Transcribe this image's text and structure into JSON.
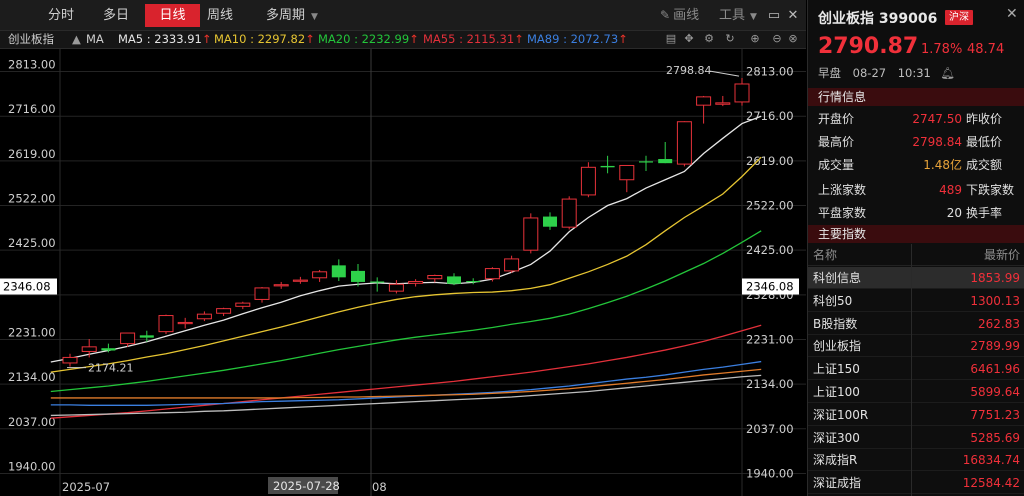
{
  "topbar": {
    "tabs": [
      {
        "label": "分时",
        "active": false
      },
      {
        "label": "多日",
        "active": false
      },
      {
        "label": "日线",
        "active": true
      },
      {
        "label": "周线",
        "active": false
      },
      {
        "label": "多周期",
        "active": false
      }
    ],
    "draw_label": "画线",
    "tools_label": "工具",
    "colors": {
      "active_tab": "#d9232d"
    }
  },
  "indicator_bar": {
    "symbol": "创业板指",
    "type": "MA",
    "ma": [
      {
        "label": "MA5 : 2333.91",
        "color": "#e6e6e6"
      },
      {
        "label": "MA10 : 2297.82",
        "color": "#e6c532"
      },
      {
        "label": "MA20 : 2232.99",
        "color": "#23c53a"
      },
      {
        "label": "MA55 : 2115.31",
        "color": "#e3303a"
      },
      {
        "label": "MA89 : 2072.73",
        "color": "#3b7fe0"
      }
    ],
    "arrow": "↑"
  },
  "chart_data": {
    "type": "candlestick",
    "ylim": [
      1891,
      2862
    ],
    "y_ticks": [
      "2813.00",
      "2716.00",
      "2619.00",
      "2522.00",
      "2425.00",
      "2328.00",
      "2231.00",
      "2134.00",
      "2037.00",
      "1940.00"
    ],
    "current_price_label": "2346.08",
    "x_labels": [
      "2025-07",
      "2025-07-28",
      "08"
    ],
    "high_marker": "2798.84",
    "low_marker": "2174.21",
    "candles": [
      {
        "o": 2180,
        "h": 2200,
        "l": 2172,
        "c": 2192
      },
      {
        "o": 2205,
        "h": 2232,
        "l": 2192,
        "c": 2215
      },
      {
        "o": 2212,
        "h": 2222,
        "l": 2203,
        "c": 2207
      },
      {
        "o": 2222,
        "h": 2240,
        "l": 2215,
        "c": 2245
      },
      {
        "o": 2240,
        "h": 2250,
        "l": 2226,
        "c": 2235
      },
      {
        "o": 2248,
        "h": 2285,
        "l": 2243,
        "c": 2283
      },
      {
        "o": 2268,
        "h": 2278,
        "l": 2255,
        "c": 2268
      },
      {
        "o": 2276,
        "h": 2292,
        "l": 2271,
        "c": 2286
      },
      {
        "o": 2288,
        "h": 2300,
        "l": 2282,
        "c": 2298
      },
      {
        "o": 2303,
        "h": 2313,
        "l": 2297,
        "c": 2310
      },
      {
        "o": 2318,
        "h": 2345,
        "l": 2311,
        "c": 2343
      },
      {
        "o": 2350,
        "h": 2356,
        "l": 2341,
        "c": 2350
      },
      {
        "o": 2360,
        "h": 2367,
        "l": 2352,
        "c": 2360
      },
      {
        "o": 2365,
        "h": 2382,
        "l": 2356,
        "c": 2378
      },
      {
        "o": 2392,
        "h": 2405,
        "l": 2358,
        "c": 2366
      },
      {
        "o": 2380,
        "h": 2395,
        "l": 2346,
        "c": 2356
      },
      {
        "o": 2357,
        "h": 2366,
        "l": 2335,
        "c": 2356
      },
      {
        "o": 2336,
        "h": 2360,
        "l": 2331,
        "c": 2351
      },
      {
        "o": 2353,
        "h": 2362,
        "l": 2346,
        "c": 2357
      },
      {
        "o": 2363,
        "h": 2372,
        "l": 2355,
        "c": 2370
      },
      {
        "o": 2368,
        "h": 2375,
        "l": 2349,
        "c": 2352
      },
      {
        "o": 2358,
        "h": 2364,
        "l": 2351,
        "c": 2356
      },
      {
        "o": 2363,
        "h": 2388,
        "l": 2357,
        "c": 2385
      },
      {
        "o": 2380,
        "h": 2413,
        "l": 2376,
        "c": 2406
      },
      {
        "o": 2425,
        "h": 2505,
        "l": 2418,
        "c": 2495
      },
      {
        "o": 2498,
        "h": 2507,
        "l": 2469,
        "c": 2476
      },
      {
        "o": 2475,
        "h": 2542,
        "l": 2470,
        "c": 2536
      },
      {
        "o": 2545,
        "h": 2616,
        "l": 2540,
        "c": 2605
      },
      {
        "o": 2608,
        "h": 2630,
        "l": 2592,
        "c": 2605
      },
      {
        "o": 2578,
        "h": 2609,
        "l": 2551,
        "c": 2609
      },
      {
        "o": 2618,
        "h": 2630,
        "l": 2597,
        "c": 2616
      },
      {
        "o": 2623,
        "h": 2660,
        "l": 2614,
        "c": 2614
      },
      {
        "o": 2612,
        "h": 2705,
        "l": 2607,
        "c": 2704
      },
      {
        "o": 2740,
        "h": 2760,
        "l": 2700,
        "c": 2758
      },
      {
        "o": 2742,
        "h": 2760,
        "l": 2738,
        "c": 2745
      },
      {
        "o": 2747,
        "h": 2799,
        "l": 2739,
        "c": 2786
      }
    ],
    "ma_series": [
      {
        "name": "MA5",
        "color": "#e6e6e6",
        "values": [
          2182,
          2190,
          2199,
          2207,
          2216,
          2226,
          2238,
          2250,
          2262,
          2273,
          2287,
          2300,
          2312,
          2326,
          2337,
          2347,
          2351,
          2354,
          2352,
          2354,
          2355,
          2352,
          2355,
          2362,
          2377,
          2394,
          2423,
          2465,
          2496,
          2522,
          2537,
          2560,
          2578,
          2596,
          2635,
          2668,
          2700,
          2716
        ]
      },
      {
        "name": "MA10",
        "color": "#e6c532",
        "values": [
          2160,
          2166,
          2172,
          2178,
          2185,
          2193,
          2200,
          2209,
          2218,
          2228,
          2238,
          2248,
          2258,
          2269,
          2280,
          2291,
          2301,
          2310,
          2318,
          2324,
          2328,
          2331,
          2333,
          2334,
          2337,
          2342,
          2350,
          2364,
          2378,
          2394,
          2412,
          2437,
          2467,
          2496,
          2521,
          2547,
          2585,
          2627
        ]
      },
      {
        "name": "MA20",
        "color": "#23c53a",
        "values": [
          2118,
          2122,
          2126,
          2130,
          2135,
          2140,
          2146,
          2152,
          2158,
          2164,
          2171,
          2178,
          2185,
          2193,
          2201,
          2209,
          2216,
          2223,
          2230,
          2236,
          2241,
          2246,
          2251,
          2257,
          2264,
          2270,
          2277,
          2286,
          2298,
          2311,
          2325,
          2341,
          2358,
          2377,
          2396,
          2418,
          2442,
          2467
        ]
      },
      {
        "name": "MA55",
        "color": "#e3303a",
        "values": [
          2060,
          2063,
          2066,
          2069,
          2072,
          2076,
          2080,
          2084,
          2088,
          2092,
          2096,
          2100,
          2104,
          2108,
          2112,
          2116,
          2120,
          2124,
          2128,
          2132,
          2136,
          2140,
          2145,
          2150,
          2155,
          2160,
          2166,
          2172,
          2178,
          2185,
          2192,
          2200,
          2208,
          2217,
          2227,
          2238,
          2250,
          2262
        ]
      },
      {
        "name": "MA89",
        "color": "#3b7fe0",
        "values": [
          2089,
          2089,
          2088,
          2088,
          2088,
          2088,
          2089,
          2090,
          2091,
          2092,
          2094,
          2096,
          2097,
          2098,
          2099,
          2100,
          2102,
          2104,
          2106,
          2108,
          2110,
          2112,
          2114,
          2116,
          2119,
          2122,
          2126,
          2130,
          2135,
          2140,
          2145,
          2149,
          2154,
          2160,
          2166,
          2171,
          2177,
          2183
        ]
      },
      {
        "name": "",
        "color": "#e07b2a",
        "values": [
          2104,
          2104,
          2104,
          2104,
          2104,
          2104,
          2104,
          2104,
          2104,
          2104,
          2104,
          2104,
          2104,
          2105,
          2105,
          2106,
          2106,
          2107,
          2108,
          2109,
          2110,
          2111,
          2112,
          2114,
          2116,
          2118,
          2121,
          2124,
          2128,
          2132,
          2136,
          2140,
          2144,
          2149,
          2154,
          2158,
          2162,
          2166
        ]
      },
      {
        "name": "",
        "color": "#bdbdbd",
        "values": [
          2066,
          2067,
          2068,
          2069,
          2070,
          2071,
          2072,
          2073,
          2075,
          2076,
          2078,
          2080,
          2082,
          2084,
          2086,
          2088,
          2090,
          2092,
          2094,
          2096,
          2098,
          2100,
          2102,
          2104,
          2106,
          2109,
          2112,
          2115,
          2118,
          2122,
          2126,
          2130,
          2134,
          2138,
          2142,
          2146,
          2150,
          2153
        ]
      }
    ]
  },
  "panel": {
    "title": "创业板指 399006",
    "badge": "沪深",
    "price": "2790.87",
    "change_pct": "1.78%",
    "change": "48.74",
    "status": "早盘",
    "date": "08-27",
    "time": "10:31",
    "quote_header": "行情信息",
    "quotes": [
      {
        "k": "开盘价",
        "v": "2747.50",
        "k2": "昨收价",
        "color": "red"
      },
      {
        "k": "最高价",
        "v": "2798.84",
        "k2": "最低价",
        "color": "red"
      },
      {
        "k": "成交量",
        "v": "1.48亿",
        "k2": "成交额",
        "color": "orange"
      },
      {
        "k": "上涨家数",
        "v": "489",
        "k2": "下跌家数",
        "color": "red"
      },
      {
        "k": "平盘家数",
        "v": "20",
        "k2": "换手率",
        "color": "white"
      }
    ],
    "index_header": "主要指数",
    "index_col_name": "名称",
    "index_col_price": "最新价",
    "indices": [
      {
        "name": "科创信息",
        "price": "1853.99",
        "selected": true
      },
      {
        "name": "科创50",
        "price": "1300.13",
        "selected": false
      },
      {
        "name": "B股指数",
        "price": "262.83",
        "selected": false
      },
      {
        "name": "创业板指",
        "price": "2789.99",
        "selected": false
      },
      {
        "name": "上证150",
        "price": "6461.96",
        "selected": false
      },
      {
        "name": "上证100",
        "price": "5899.64",
        "selected": false
      },
      {
        "name": "深证100R",
        "price": "7751.23",
        "selected": false
      },
      {
        "name": "深证300",
        "price": "5285.69",
        "selected": false
      },
      {
        "name": "深成指R",
        "price": "16834.74",
        "selected": false
      },
      {
        "name": "深证成指",
        "price": "12584.42",
        "selected": false
      }
    ]
  }
}
